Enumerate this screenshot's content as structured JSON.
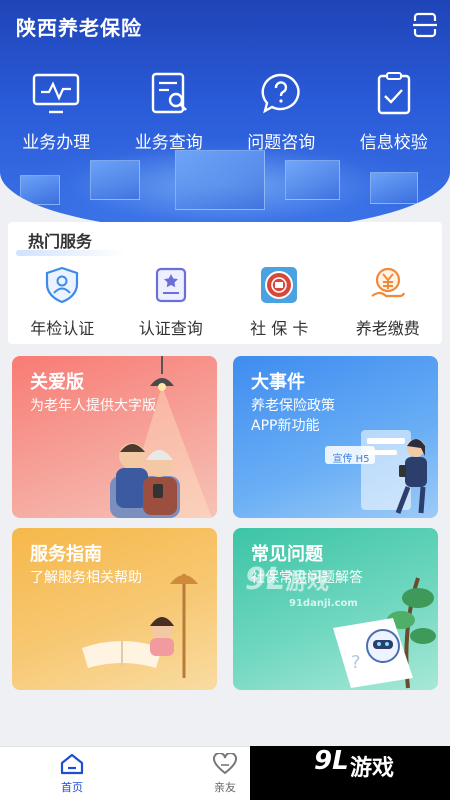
{
  "app": {
    "title": "陕西养老保险"
  },
  "quick_actions": [
    {
      "label": "业务办理",
      "icon": "monitor-chart-icon"
    },
    {
      "label": "业务查询",
      "icon": "document-search-icon"
    },
    {
      "label": "问题咨询",
      "icon": "question-bubble-icon"
    },
    {
      "label": "信息校验",
      "icon": "document-check-icon"
    }
  ],
  "hot_services": {
    "title": "热门服务",
    "items": [
      {
        "label": "年检认证",
        "icon": "shield-person-icon"
      },
      {
        "label": "认证查询",
        "icon": "badge-document-icon"
      },
      {
        "label": "社 保 卡",
        "icon": "social-security-card-icon"
      },
      {
        "label": "养老缴费",
        "icon": "yuan-hand-icon"
      }
    ]
  },
  "cards": [
    {
      "title": "关爱版",
      "subtitle": "为老年人提供大字版"
    },
    {
      "title": "大事件",
      "subtitle": "养老保险政策\nAPP新功能",
      "badge": "宣传 H5"
    },
    {
      "title": "服务指南",
      "subtitle": "了解服务相关帮助"
    },
    {
      "title": "常见问题",
      "subtitle": "社保常见问题解答"
    }
  ],
  "bottom_nav": [
    {
      "label": "首页",
      "active": true
    },
    {
      "label": "亲友",
      "active": false
    }
  ],
  "watermark": {
    "brand_num": "9L",
    "brand_text": "游戏",
    "site": "91danji.com"
  },
  "colors": {
    "primary": "#2a5bd8",
    "active_nav": "#1f4fd0"
  }
}
